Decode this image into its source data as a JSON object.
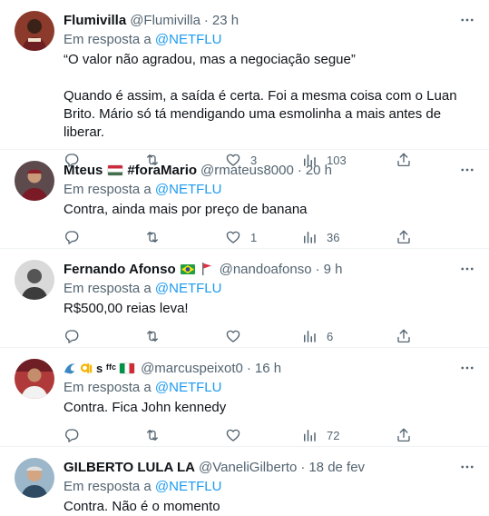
{
  "reply_prefix": "Em resposta a",
  "tweets": [
    {
      "name": "Flumivilla",
      "handle": "@Flumivilla",
      "time": "23 h",
      "reply_to": "@NETFLU",
      "text": "“O valor não agradou, mas a negociação segue”\n\nQuando é assim, a saída é certa. Foi a mesma coisa com o Luan Brito. Mário só tá mendigando uma esmolinha a mais antes de liberar.",
      "replies": "",
      "retweets": "",
      "likes": "3",
      "views": "103"
    },
    {
      "name": "Mteus",
      "name_suffix": "#foraMario",
      "handle": "@rmateus8000",
      "time": "20 h",
      "reply_to": "@NETFLU",
      "text": "Contra, ainda mais por preço de banana",
      "replies": "",
      "retweets": "",
      "likes": "1",
      "views": "36"
    },
    {
      "name": "Fernando Afonso",
      "handle": "@nandoafonso",
      "time": "9 h",
      "reply_to": "@NETFLU",
      "text": "R$500,00 reias leva!",
      "replies": "",
      "retweets": "",
      "likes": "",
      "views": "6"
    },
    {
      "name": "s ᶠᶠᶜ",
      "handle": "@marcuspeixot0",
      "time": "16 h",
      "reply_to": "@NETFLU",
      "text": "Contra. Fica John kennedy",
      "replies": "",
      "retweets": "",
      "likes": "",
      "views": "72"
    },
    {
      "name": "GILBERTO LULA LA",
      "handle": "@VaneliGilberto",
      "time": "18 de fev",
      "reply_to": "@NETFLU",
      "text": "Contra. Não é o momento"
    }
  ],
  "colors": {
    "text_primary": "#0f1419",
    "text_secondary": "#536471",
    "link": "#1d9bf0",
    "divider": "#eff3f4"
  },
  "icons": [
    "more-icon",
    "reply-icon",
    "retweet-icon",
    "like-icon",
    "views-icon",
    "share-icon"
  ]
}
